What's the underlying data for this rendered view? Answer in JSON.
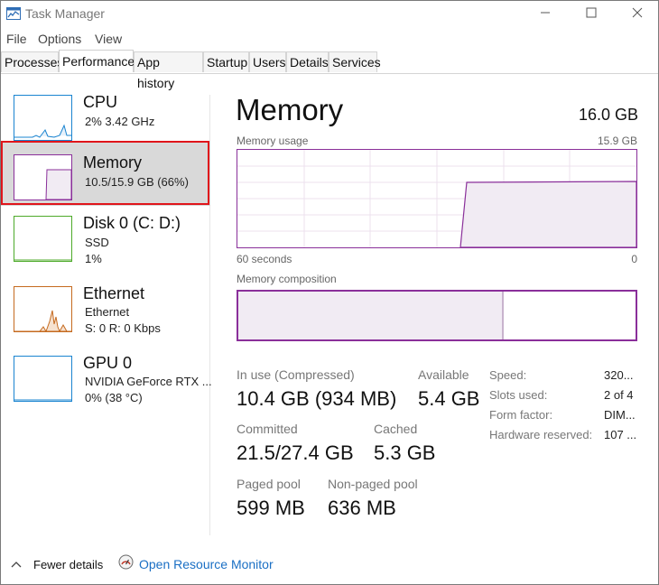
{
  "window": {
    "title": "Task Manager",
    "icon": "task-manager-icon",
    "controls": [
      "minimize-icon",
      "maximize-icon",
      "close-icon"
    ]
  },
  "menu": [
    "File",
    "Options",
    "View"
  ],
  "tabs": [
    "Processes",
    "Performance",
    "App history",
    "Startup",
    "Users",
    "Details",
    "Services"
  ],
  "active_tab": "Performance",
  "sidebar": {
    "items": [
      {
        "name": "CPU",
        "sub1": "2% 3.42 GHz",
        "sub2": "",
        "color": "#1a84d0"
      },
      {
        "name": "Memory",
        "sub1": "10.5/15.9 GB (66%)",
        "sub2": "",
        "color": "#8a2f9a",
        "selected": true
      },
      {
        "name": "Disk 0 (C: D:)",
        "sub1": "SSD",
        "sub2": "1%",
        "color": "#4daa2a"
      },
      {
        "name": "Ethernet",
        "sub1": "Ethernet",
        "sub2": "S: 0 R: 0 Kbps",
        "color": "#c56a1f"
      },
      {
        "name": "GPU 0",
        "sub1": "NVIDIA GeForce RTX ...",
        "sub2": "0% (38 °C)",
        "color": "#1a84d0"
      }
    ]
  },
  "main": {
    "title": "Memory",
    "total": "16.0 GB",
    "usage_label": "Memory usage",
    "usage_max": "15.9 GB",
    "time_left": "60 seconds",
    "time_right": "0",
    "composition_label": "Memory composition",
    "in_use_label": "In use (Compressed)",
    "in_use_value": "10.4 GB (934 MB)",
    "available_label": "Available",
    "available_value": "5.4 GB",
    "committed_label": "Committed",
    "committed_value": "21.5/27.4 GB",
    "cached_label": "Cached",
    "cached_value": "5.3 GB",
    "paged_label": "Paged pool",
    "paged_value": "599 MB",
    "nonpaged_label": "Non-paged pool",
    "nonpaged_value": "636 MB",
    "specs": [
      {
        "label": "Speed:",
        "value": "320..."
      },
      {
        "label": "Slots used:",
        "value": "2 of 4"
      },
      {
        "label": "Form factor:",
        "value": "DIM..."
      },
      {
        "label": "Hardware reserved:",
        "value": "107 ..."
      }
    ],
    "accent": "#8a2f9a"
  },
  "footer": {
    "fewer_details": "Fewer details",
    "open_monitor": "Open Resource Monitor"
  }
}
